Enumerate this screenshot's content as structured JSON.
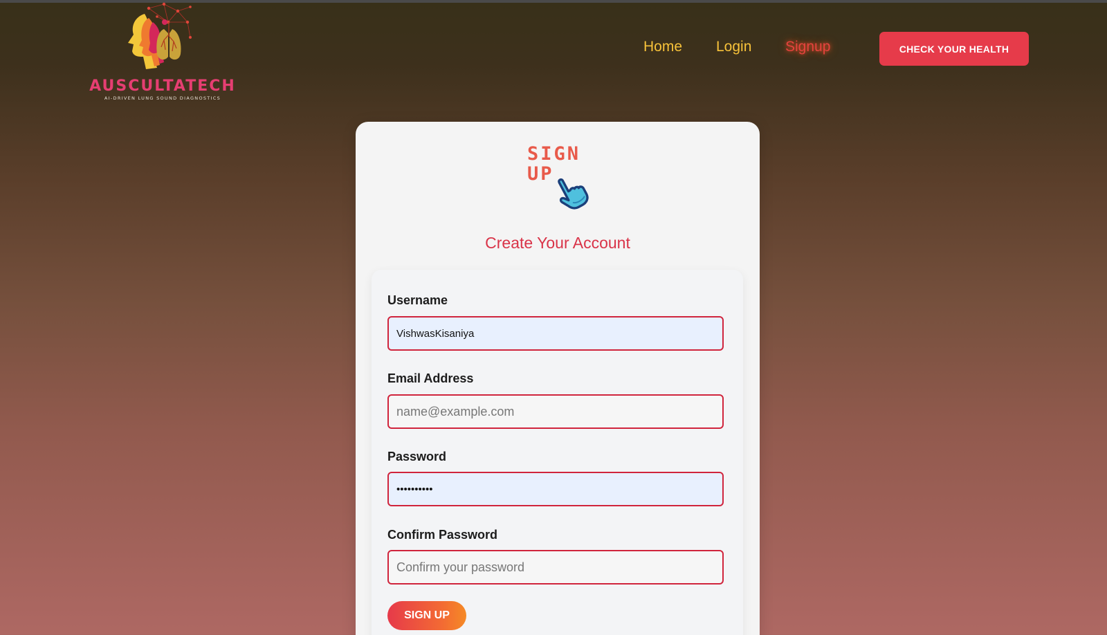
{
  "brand": {
    "name": "AUSCULTATECH",
    "tagline": "AI-DRIVEN LUNG SOUND DIAGNOSTICS",
    "colors": {
      "name": "#e63e72",
      "accent": "#e63b4a",
      "nav": "#f7c23a"
    }
  },
  "nav": {
    "items": [
      {
        "label": "Home",
        "active": false
      },
      {
        "label": "Login",
        "active": false
      },
      {
        "label": "Signup",
        "active": true
      }
    ],
    "cta_label": "CHECK YOUR HEALTH"
  },
  "card": {
    "badge_line1": "SIGN",
    "badge_line2": "UP",
    "badge_icon": "pointing-hand-icon",
    "title": "Create Your Account"
  },
  "form": {
    "username": {
      "label": "Username",
      "value": "VishwasKisaniya",
      "placeholder": ""
    },
    "email": {
      "label": "Email Address",
      "value": "",
      "placeholder": "name@example.com"
    },
    "password": {
      "label": "Password",
      "value": "••••••••••",
      "placeholder": ""
    },
    "confirm": {
      "label": "Confirm Password",
      "value": "",
      "placeholder": "Confirm your password"
    },
    "submit_label": "SIGN UP"
  }
}
